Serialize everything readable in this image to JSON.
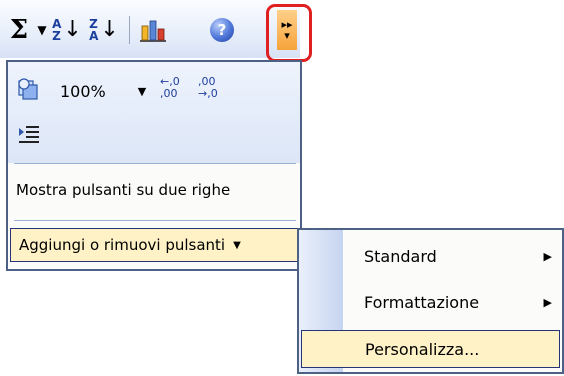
{
  "toolbar": {
    "sigma": "Σ",
    "sigma_dropdown": "▼",
    "sort_asc": {
      "top": "A",
      "bottom": "Z",
      "arrow": "↓"
    },
    "sort_desc": {
      "top": "Z",
      "bottom": "A",
      "arrow": "↓"
    },
    "help": "?",
    "overflow_dots": "▸▸",
    "overflow_arrow": "▾",
    "highlight_color": "#e02020"
  },
  "panel": {
    "zoom_value": "100%",
    "zoom_dropdown": "▼",
    "increase_decimal": {
      "top": "←,0",
      "bottom": ",00"
    },
    "decrease_decimal": {
      "top": ",00",
      "bottom": "→,0"
    },
    "two_rows_label": "Mostra pulsanti su due righe",
    "add_remove_label": "Aggiungi o rimuovi pulsanti",
    "add_remove_caret": "▼"
  },
  "submenu": {
    "items": [
      {
        "label": "Standard",
        "arrow": "▶"
      },
      {
        "label": "Formattazione",
        "arrow": "▶"
      },
      {
        "label": "Personalizza..."
      }
    ]
  },
  "colors": {
    "menu_highlight": "#fff2c6",
    "menu_border": "#4d6185",
    "toolbar_gradient_top": "#fbfcfe",
    "toolbar_gradient_bottom": "#d7e2f6"
  }
}
